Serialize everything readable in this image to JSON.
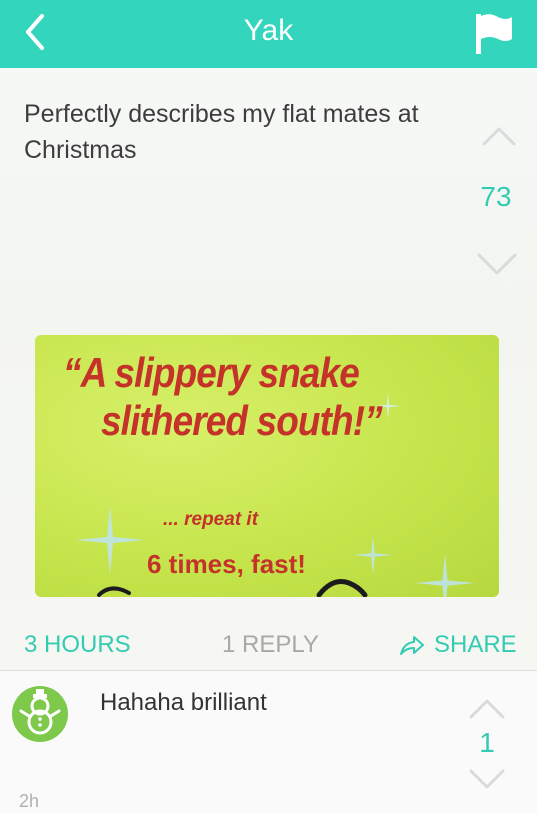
{
  "header": {
    "title": "Yak",
    "background": "#33d6bc",
    "back_icon": "chevron-left-icon",
    "flag_icon": "flag-icon"
  },
  "post": {
    "text": "Perfectly describes my flat mates at Christmas",
    "score": "73",
    "image": {
      "line1": "“A slippery snake",
      "line2": "slithered south!”",
      "line3": "... repeat it",
      "line4": "6 times, fast!"
    },
    "footer": {
      "time": "3 HOURS",
      "replies": "1 REPLY",
      "share": "SHARE"
    }
  },
  "reply": {
    "text": "Hahaha brilliant",
    "score": "1",
    "time": "2h",
    "avatar_icon": "snowman-icon",
    "avatar_color": "#7ec94c"
  },
  "colors": {
    "accent": "#33ccb3",
    "meme_text": "#c4322a",
    "meme_background": "#c6e54c"
  }
}
